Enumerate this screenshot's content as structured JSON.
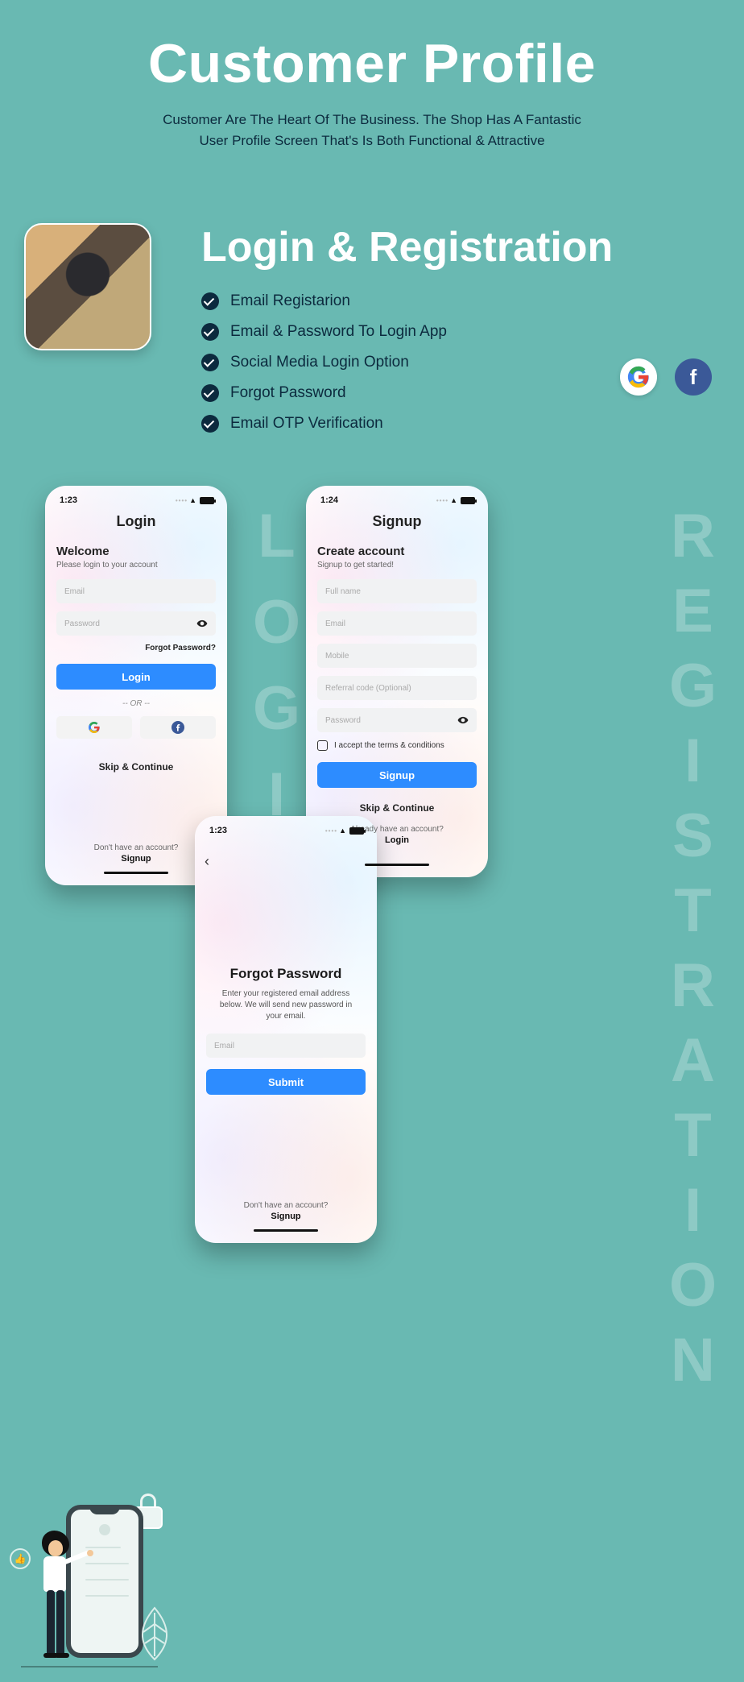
{
  "hero": {
    "title": "Customer Profile",
    "subtitle_line1": "Customer Are The Heart Of The Business. The Shop Has A Fantastic",
    "subtitle_line2": "User Profile Screen That's Is Both Functional & Attractive"
  },
  "feature_section": {
    "title": "Login & Registration",
    "items": [
      "Email Registarion",
      "Email & Password To Login App",
      "Social Media Login Option",
      "Forgot Password",
      "Email OTP Verification"
    ]
  },
  "vertical_labels": {
    "login": "LOGIN",
    "registration": "REGISTRATION"
  },
  "login_screen": {
    "status_time": "1:23",
    "title": "Login",
    "heading": "Welcome",
    "subheading": "Please login to your account",
    "email_ph": "Email",
    "password_ph": "Password",
    "forgot": "Forgot Password?",
    "login_btn": "Login",
    "or_text": "-- OR --",
    "skip": "Skip & Continue",
    "prompt": "Don't have an account?",
    "action": "Signup"
  },
  "signup_screen": {
    "status_time": "1:24",
    "title": "Signup",
    "heading": "Create account",
    "subheading": "Signup to get started!",
    "fullname_ph": "Full name",
    "email_ph": "Email",
    "mobile_ph": "Mobile",
    "referral_ph": "Referral code (Optional)",
    "password_ph": "Password",
    "terms": "I accept the terms & conditions",
    "signup_btn": "Signup",
    "skip": "Skip & Continue",
    "prompt": "Already have an account?",
    "action": "Login"
  },
  "forgot_screen": {
    "status_time": "1:23",
    "title": "Forgot Password",
    "desc": "Enter your registered email address below. We will send new password in your email.",
    "email_ph": "Email",
    "submit_btn": "Submit",
    "prompt": "Don't have an account?",
    "action": "Signup"
  }
}
